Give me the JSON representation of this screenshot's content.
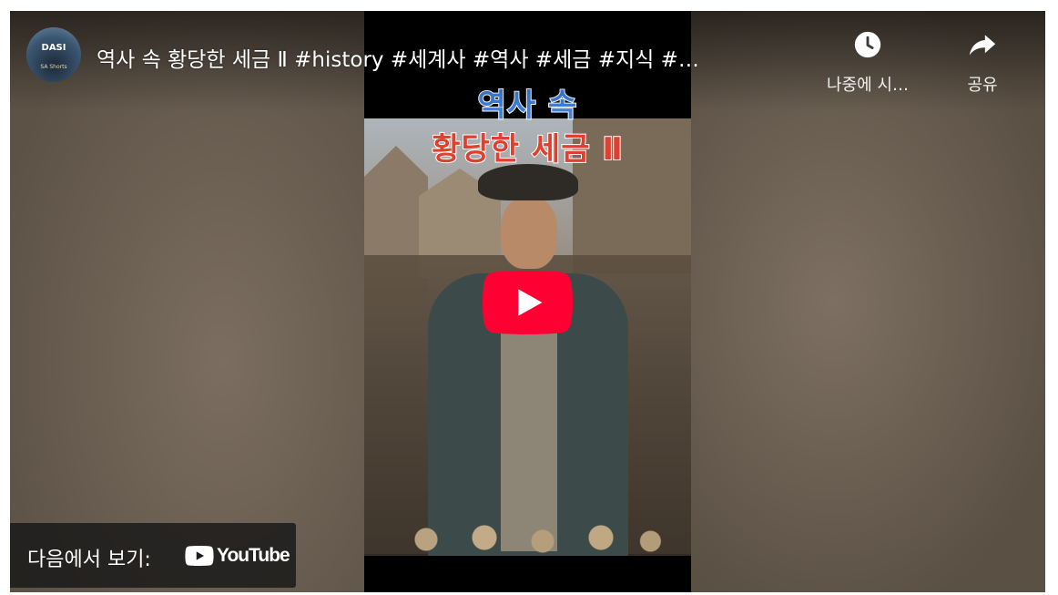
{
  "video": {
    "title": "역사 속 황당한 세금 Ⅱ #history #세계사 #역사 #세금 #지식 #…",
    "caption_line1": "역사 속",
    "caption_line2": "황당한 세금 Ⅱ"
  },
  "channel": {
    "avatar_text": "DASI",
    "avatar_sub": "SA Shorts"
  },
  "actions": {
    "watch_later_label": "나중에 시…",
    "share_label": "공유"
  },
  "watch_on": {
    "label": "다음에서 보기:",
    "brand": "YouTube"
  },
  "icons": {
    "watch_later": "clock-icon",
    "share": "share-arrow-icon",
    "play": "play-icon",
    "brand": "youtube-logo-icon"
  },
  "colors": {
    "play_button": "#ff0033",
    "caption_blue": "#3f7fd9",
    "caption_red": "#e0402f"
  }
}
